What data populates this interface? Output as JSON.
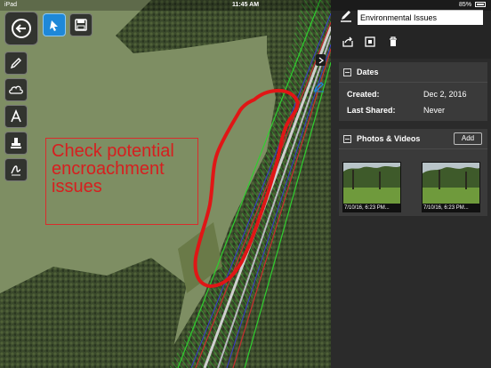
{
  "status": {
    "device": "iPad",
    "time": "11:45 AM",
    "battery": "85%"
  },
  "callout": {
    "text": "Check potential encroachment issues"
  },
  "toolbar": {
    "tools": [
      "back-icon",
      "select-icon",
      "save-icon",
      "pen-icon",
      "cloud-icon",
      "text-icon",
      "stamp-icon",
      "signature-icon"
    ]
  },
  "panel": {
    "title_value": "Environmental Issues",
    "dates": {
      "header": "Dates",
      "created_label": "Created:",
      "created_value": "Dec 2, 2016",
      "shared_label": "Last Shared:",
      "shared_value": "Never"
    },
    "photos": {
      "header": "Photos & Videos",
      "add_label": "Add",
      "items": [
        {
          "caption": "7/10/16, 6:23 PM..."
        },
        {
          "caption": "7/10/16, 6:23 PM..."
        }
      ]
    }
  },
  "colors": {
    "accent": "#1e88d8",
    "markup": "#e01616",
    "panel": "#2b2b2b"
  }
}
